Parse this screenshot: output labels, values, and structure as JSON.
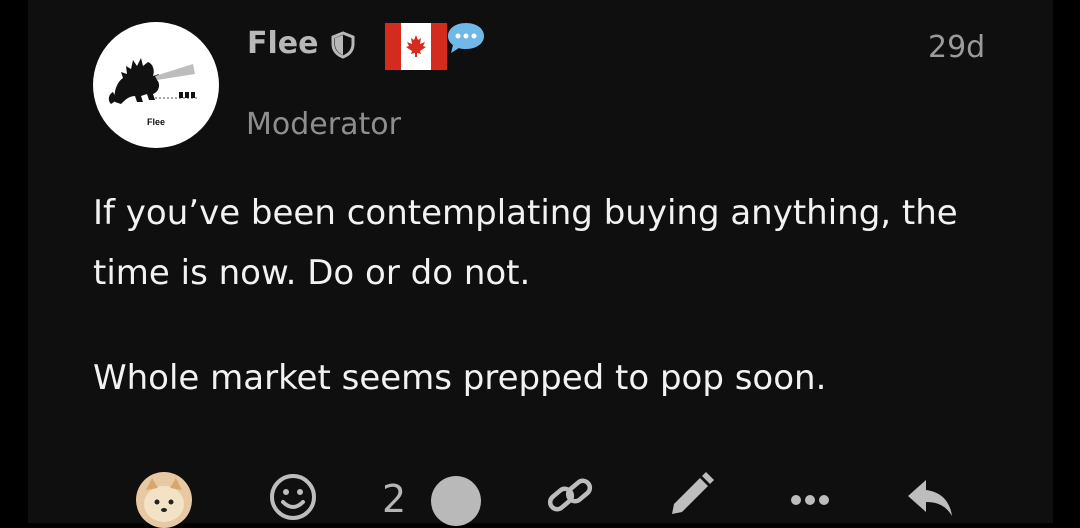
{
  "post": {
    "author": {
      "username": "Flee",
      "role": "Moderator",
      "avatar_text": "Flee"
    },
    "timestamp": "29d",
    "badges": {
      "flag": "canada-flag-icon",
      "shield": "shield-icon",
      "bubble": "speech-bubble-icon"
    },
    "paragraphs": [
      "If you’ve been contemplating buying anything, the time is now. Do or do not.",
      "Whole market seems prepped to pop soon."
    ],
    "actions": {
      "like_count": "2"
    }
  },
  "colors": {
    "background": "#0f0f10",
    "text": "#f2f2f2",
    "muted": "#8e8e8e",
    "flag_red": "#d52b1e",
    "bubble_blue": "#6fb8e8"
  }
}
